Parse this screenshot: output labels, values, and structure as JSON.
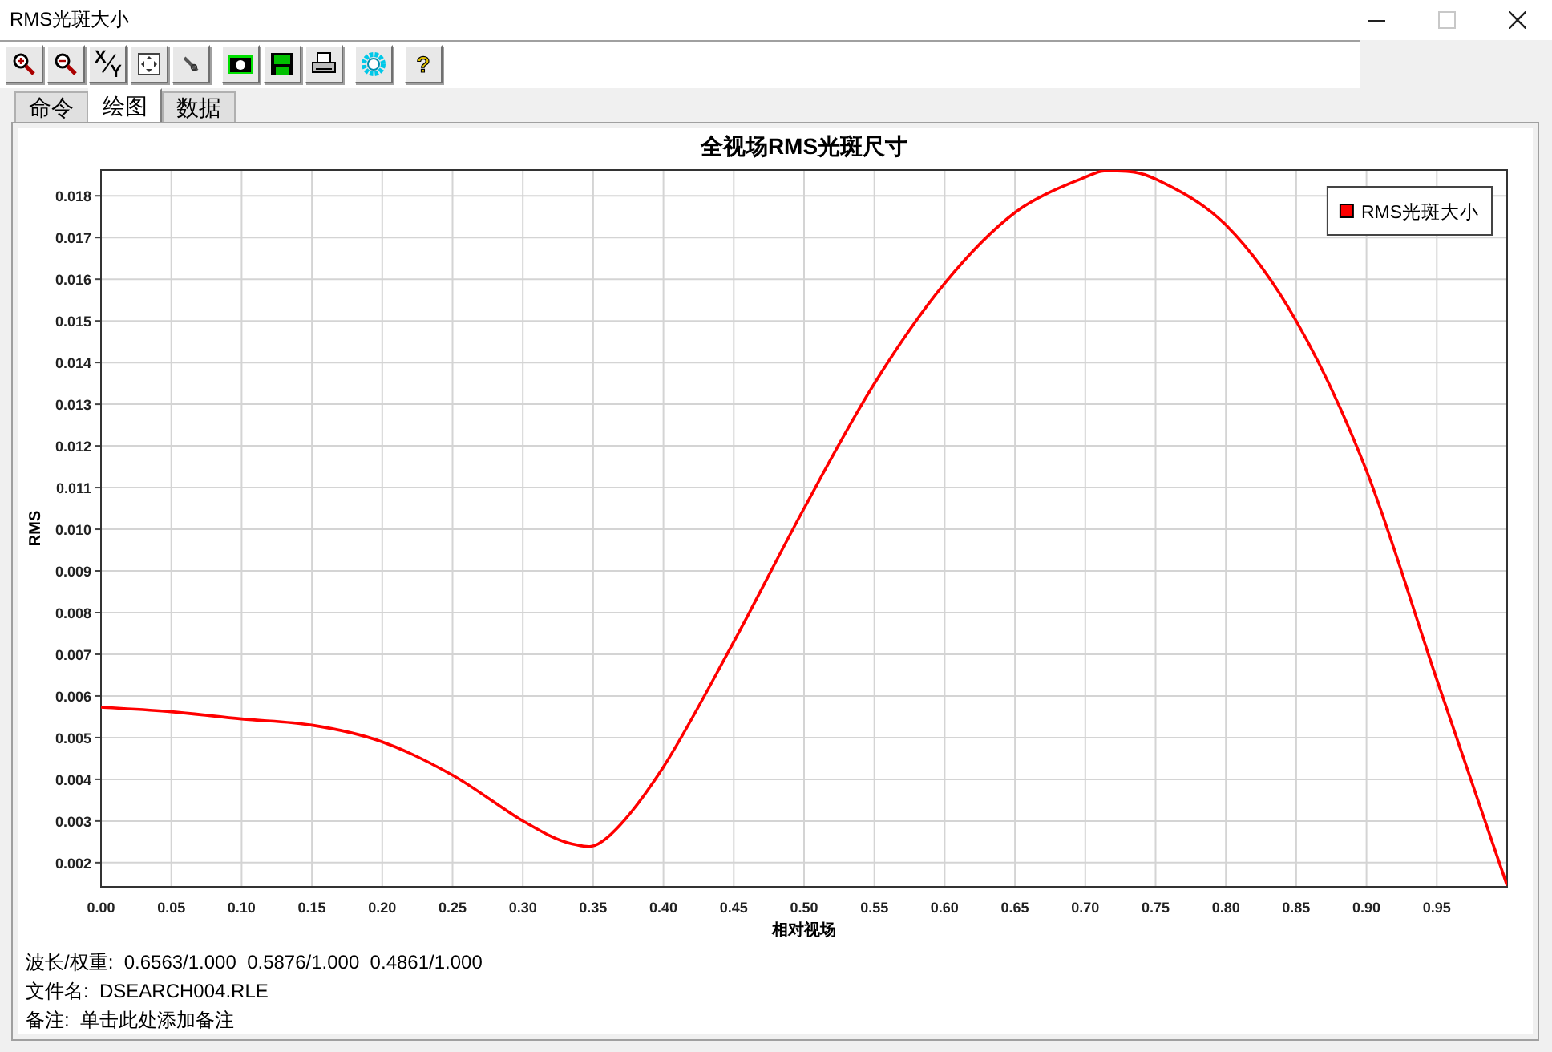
{
  "window": {
    "title": "RMS光斑大小",
    "controls": [
      {
        "kind": "minimize",
        "disabled": false
      },
      {
        "kind": "maximize",
        "disabled": true
      },
      {
        "kind": "close",
        "disabled": false
      }
    ]
  },
  "toolbar": [
    [
      {
        "kind": "zoom-in"
      },
      {
        "kind": "zoom-out"
      },
      {
        "kind": "xy",
        "glyphs": [
          "X",
          "Y"
        ]
      },
      {
        "kind": "fit"
      },
      {
        "kind": "pen"
      }
    ],
    [
      {
        "kind": "camera"
      },
      {
        "kind": "save"
      },
      {
        "kind": "print"
      }
    ],
    [
      {
        "kind": "settings"
      }
    ],
    [
      {
        "kind": "help",
        "glyph": "?"
      }
    ]
  ],
  "tabs": [
    {
      "label": "命令",
      "selected": false
    },
    {
      "label": "绘图",
      "selected": true
    },
    {
      "label": "数据",
      "selected": false
    }
  ],
  "chart": {
    "chart_data": {
      "type": "line",
      "title": "全视场RMS光斑尺寸",
      "xlabel": "相对视场",
      "ylabel": "RMS",
      "x": [
        0,
        0.05,
        0.1,
        0.15,
        0.2,
        0.25,
        0.3,
        0.335,
        0.36,
        0.4,
        0.45,
        0.5,
        0.55,
        0.6,
        0.65,
        0.7,
        0.72,
        0.75,
        0.8,
        0.85,
        0.9,
        0.95,
        1
      ],
      "series": [
        {
          "name": "RMS光斑大小",
          "color": "#ff0000",
          "values": [
            0.00573,
            0.00562,
            0.00545,
            0.0053,
            0.0049,
            0.0041,
            0.003,
            0.00245,
            0.0026,
            0.0043,
            0.0073,
            0.0105,
            0.0135,
            0.0159,
            0.0176,
            0.01845,
            0.0186,
            0.0184,
            0.0173,
            0.015,
            0.0114,
            0.0064,
            0.00145
          ]
        }
      ],
      "xlim": [
        0,
        1
      ],
      "ylim": [
        0.00142,
        0.01862
      ],
      "xticks": [
        {
          "value": 0,
          "label": "0.00"
        },
        {
          "value": 0.05,
          "label": "0.05"
        },
        {
          "value": 0.1,
          "label": "0.10"
        },
        {
          "value": 0.15,
          "label": "0.15"
        },
        {
          "value": 0.2,
          "label": "0.20"
        },
        {
          "value": 0.25,
          "label": "0.25"
        },
        {
          "value": 0.3,
          "label": "0.30"
        },
        {
          "value": 0.35,
          "label": "0.35"
        },
        {
          "value": 0.4,
          "label": "0.40"
        },
        {
          "value": 0.45,
          "label": "0.45"
        },
        {
          "value": 0.5,
          "label": "0.50"
        },
        {
          "value": 0.55,
          "label": "0.55"
        },
        {
          "value": 0.6,
          "label": "0.60"
        },
        {
          "value": 0.65,
          "label": "0.65"
        },
        {
          "value": 0.7,
          "label": "0.70"
        },
        {
          "value": 0.75,
          "label": "0.75"
        },
        {
          "value": 0.8,
          "label": "0.80"
        },
        {
          "value": 0.85,
          "label": "0.85"
        },
        {
          "value": 0.9,
          "label": "0.90"
        },
        {
          "value": 0.95,
          "label": "0.95"
        }
      ],
      "yticks": [
        {
          "value": 0.002,
          "label": "0.002"
        },
        {
          "value": 0.003,
          "label": "0.003"
        },
        {
          "value": 0.004,
          "label": "0.004"
        },
        {
          "value": 0.005,
          "label": "0.005"
        },
        {
          "value": 0.006,
          "label": "0.006"
        },
        {
          "value": 0.007,
          "label": "0.007"
        },
        {
          "value": 0.008,
          "label": "0.008"
        },
        {
          "value": 0.009,
          "label": "0.009"
        },
        {
          "value": 0.01,
          "label": "0.010"
        },
        {
          "value": 0.011,
          "label": "0.011"
        },
        {
          "value": 0.012,
          "label": "0.012"
        },
        {
          "value": 0.013,
          "label": "0.013"
        },
        {
          "value": 0.014,
          "label": "0.014"
        },
        {
          "value": 0.015,
          "label": "0.015"
        },
        {
          "value": 0.016,
          "label": "0.016"
        },
        {
          "value": 0.017,
          "label": "0.017"
        },
        {
          "value": 0.018,
          "label": "0.018"
        }
      ],
      "grid": true
    }
  },
  "notes": [
    "波长/权重:  0.6563/1.000  0.5876/1.000  0.4861/1.000",
    "文件名:  DSEARCH004.RLE",
    "备注:  单击此处添加备注"
  ]
}
